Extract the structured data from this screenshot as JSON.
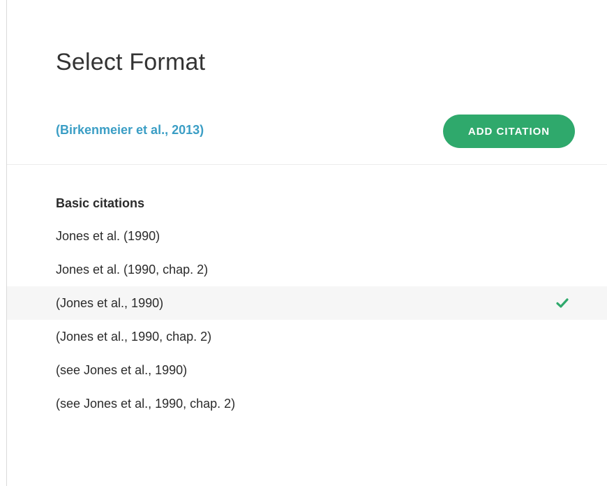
{
  "title": "Select Format",
  "preview_citation": "(Birkenmeier et al., 2013)",
  "add_button_label": "ADD CITATION",
  "section_heading": "Basic citations",
  "formats": [
    {
      "label": "Jones et al. (1990)",
      "selected": false
    },
    {
      "label": "Jones et al. (1990, chap. 2)",
      "selected": false
    },
    {
      "label": "(Jones et al., 1990)",
      "selected": true
    },
    {
      "label": "(Jones et al., 1990, chap. 2)",
      "selected": false
    },
    {
      "label": "(see Jones et al., 1990)",
      "selected": false
    },
    {
      "label": "(see Jones et al., 1990, chap. 2)",
      "selected": false
    }
  ],
  "colors": {
    "link": "#3b9ec5",
    "button": "#2fa96c",
    "check": "#2fa96c",
    "selected_row_bg": "#f6f6f6"
  },
  "icons": {
    "selected_marker": "check-icon"
  }
}
